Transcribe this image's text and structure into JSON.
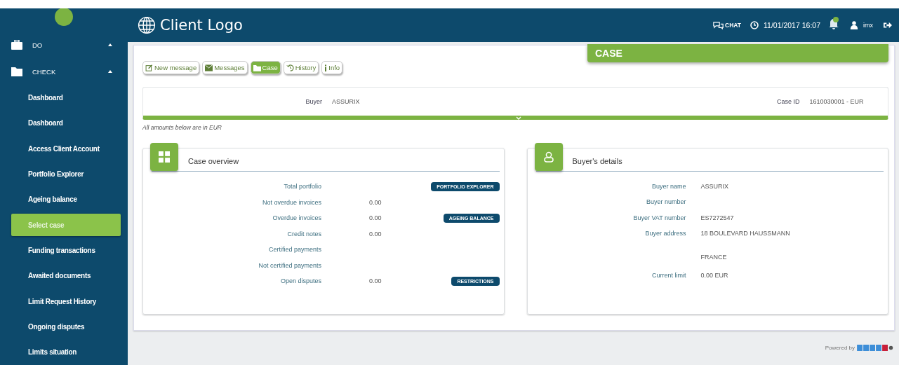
{
  "header": {
    "logo": "Client Logo",
    "chat": "CHAT",
    "datetime": "11/01/2017 16:07",
    "user": "imx"
  },
  "sidebar": {
    "sections": [
      {
        "label": "DO"
      },
      {
        "label": "CHECK"
      }
    ],
    "items": [
      {
        "label": "Dashboard",
        "selected": false
      },
      {
        "label": "Dashboard",
        "selected": false
      },
      {
        "label": "Access Client Account",
        "selected": false
      },
      {
        "label": "Portfolio Explorer",
        "selected": false
      },
      {
        "label": "Ageing balance",
        "selected": false
      },
      {
        "label": "Select case",
        "selected": true
      },
      {
        "label": "Funding transactions",
        "selected": false
      },
      {
        "label": "Awaited documents",
        "selected": false
      },
      {
        "label": "Limit Request History",
        "selected": false
      },
      {
        "label": "Ongoing disputes",
        "selected": false
      },
      {
        "label": "Limits situation",
        "selected": false
      }
    ]
  },
  "page_title": "CASE",
  "tabs": [
    {
      "label": "New message",
      "selected": false
    },
    {
      "label": "Messages",
      "selected": false
    },
    {
      "label": "Case",
      "selected": true
    },
    {
      "label": "History",
      "selected": false
    },
    {
      "label": "Info",
      "selected": false
    }
  ],
  "summary": [
    {
      "label": "Buyer",
      "value": "ASSURIX"
    },
    {
      "label": "Case ID",
      "value": "1610030001 - EUR"
    }
  ],
  "note": "All amounts below are in EUR",
  "case_overview": {
    "title": "Case overview",
    "rows": [
      {
        "label": "Total portfolio",
        "button": "PORTFOLIO EXPLORER"
      },
      {
        "label": "Not overdue invoices",
        "value": "0.00"
      },
      {
        "label": "Overdue invoices",
        "value": "0.00",
        "button": "AGEING BALANCE"
      },
      {
        "label": "Credit notes",
        "value": "0.00"
      },
      {
        "label": "Certified payments"
      },
      {
        "label": "Not certified payments"
      },
      {
        "label": "Open disputes",
        "value": "0.00",
        "button": "RESTRICTIONS"
      }
    ]
  },
  "buyer_details": {
    "title": "Buyer's details",
    "rows": [
      {
        "label": "Buyer name",
        "value": "ASSURIX"
      },
      {
        "label": "Buyer number"
      },
      {
        "label": "Buyer VAT number",
        "value": "ES7272547"
      },
      {
        "label": "Buyer address",
        "value": "18 BOULEVARD HAUSSMANN"
      },
      {
        "value": "FRANCE"
      },
      {
        "label": "Current limit",
        "value": "0.00 EUR"
      }
    ]
  },
  "footer": {
    "powered_by": "Powered by"
  }
}
